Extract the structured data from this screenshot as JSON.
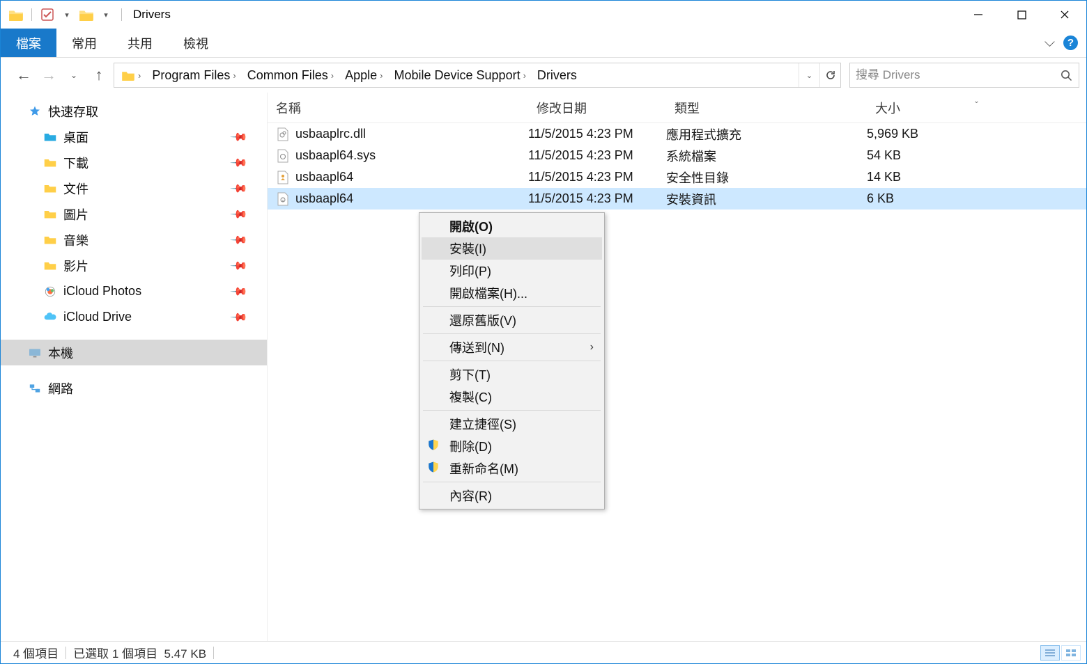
{
  "title": "Drivers",
  "ribbon": {
    "file": "檔案",
    "home": "常用",
    "share": "共用",
    "view": "檢視"
  },
  "breadcrumbs": [
    "Program Files",
    "Common Files",
    "Apple",
    "Mobile Device Support",
    "Drivers"
  ],
  "search": {
    "placeholder": "搜尋 Drivers"
  },
  "sidebar": {
    "quick_access": "快速存取",
    "items": [
      {
        "label": "桌面"
      },
      {
        "label": "下載"
      },
      {
        "label": "文件"
      },
      {
        "label": "圖片"
      },
      {
        "label": "音樂"
      },
      {
        "label": "影片"
      },
      {
        "label": "iCloud Photos"
      },
      {
        "label": "iCloud Drive"
      }
    ],
    "this_pc": "本機",
    "network": "網路"
  },
  "columns": {
    "name": "名稱",
    "date": "修改日期",
    "type": "類型",
    "size": "大小"
  },
  "files": [
    {
      "name": "usbaaplrc.dll",
      "date": "11/5/2015 4:23 PM",
      "type": "應用程式擴充",
      "size": "5,969 KB"
    },
    {
      "name": "usbaapl64.sys",
      "date": "11/5/2015 4:23 PM",
      "type": "系統檔案",
      "size": "54 KB"
    },
    {
      "name": "usbaapl64",
      "date": "11/5/2015 4:23 PM",
      "type": "安全性目錄",
      "size": "14 KB"
    },
    {
      "name": "usbaapl64",
      "date": "11/5/2015 4:23 PM",
      "type": "安裝資訊",
      "size": "6 KB"
    }
  ],
  "context": {
    "open": "開啟(O)",
    "install": "安裝(I)",
    "print": "列印(P)",
    "open_with": "開啟檔案(H)...",
    "restore": "還原舊版(V)",
    "send_to": "傳送到(N)",
    "cut": "剪下(T)",
    "copy": "複製(C)",
    "shortcut": "建立捷徑(S)",
    "delete": "刪除(D)",
    "rename": "重新命名(M)",
    "properties": "內容(R)"
  },
  "status": {
    "count": "4 個項目",
    "selected": "已選取 1 個項目",
    "size": "5.47 KB"
  }
}
